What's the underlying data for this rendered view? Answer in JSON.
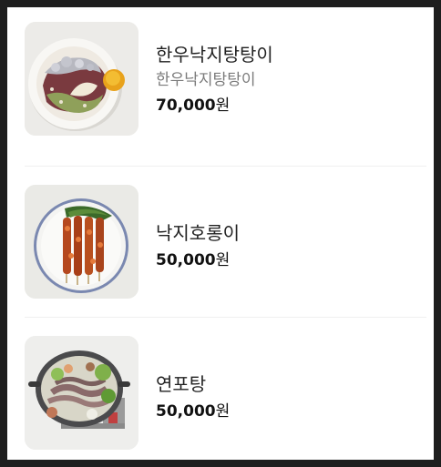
{
  "menu": {
    "items": [
      {
        "name": "한우낙지탕탕이",
        "description": "한우낙지탕탕이",
        "price": "70,000",
        "currency": "원",
        "image_icon": "beef-octopus-tartare-photo"
      },
      {
        "name": "낙지호롱이",
        "price": "50,000",
        "currency": "원",
        "image_icon": "octopus-skewer-photo"
      },
      {
        "name": "연포탕",
        "price": "50,000",
        "currency": "원",
        "image_icon": "octopus-hotpot-photo"
      }
    ]
  },
  "colors": {
    "title_text": "#222222",
    "description_text": "#7b7b7b",
    "price_text": "#111111",
    "divider": "#f0f0f0",
    "page_background": "#ffffff",
    "outer_background": "#1e1e1e"
  }
}
